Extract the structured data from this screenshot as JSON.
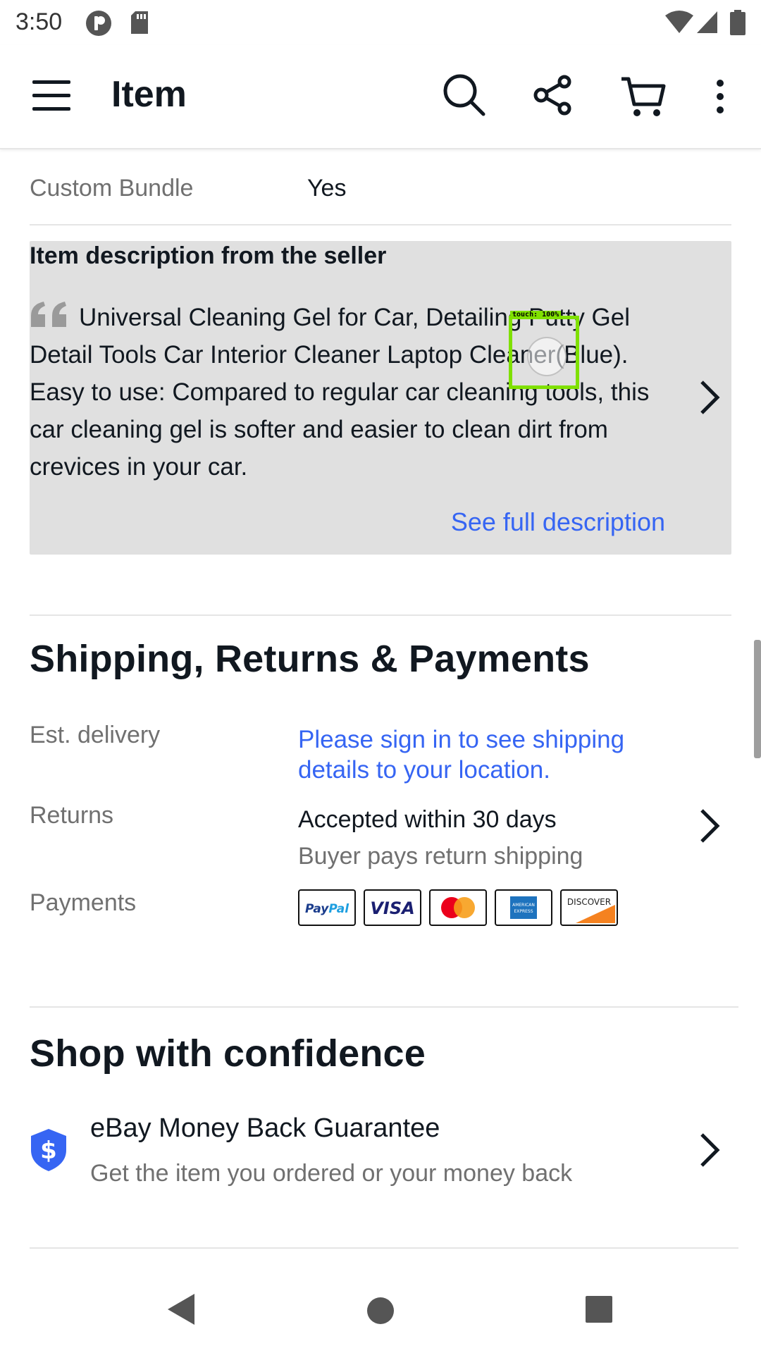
{
  "status_bar": {
    "time": "3:50"
  },
  "app_bar": {
    "title": "Item"
  },
  "specifics": {
    "label": "Custom Bundle",
    "value": "Yes"
  },
  "description": {
    "heading": "Item description from the seller",
    "text": "Universal Cleaning Gel for Car, Detailing Putty Gel Detail Tools Car Interior Cleaner Laptop Cleaner(Blue). Easy to use: Compared to regular car cleaning tools, this car cleaning gel is softer and easier to clean dirt from crevices in your car.",
    "see_full": "See full description"
  },
  "touch_overlay": {
    "label": "touch: 100%"
  },
  "shipping": {
    "heading": "Shipping, Returns & Payments",
    "delivery_label": "Est. delivery",
    "delivery_value": "Please sign in to see shipping details to your location.",
    "returns_label": "Returns",
    "returns_value": "Accepted within 30 days",
    "returns_sub": "Buyer pays return shipping",
    "payments_label": "Payments",
    "payment_methods": [
      "PayPal",
      "VISA",
      "Mastercard",
      "AMERICAN EXPRESS",
      "DISCOVER"
    ]
  },
  "confidence": {
    "heading": "Shop with confidence",
    "guarantee_title": "eBay Money Back Guarantee",
    "guarantee_sub": "Get the item you ordered or your money back"
  },
  "colors": {
    "link_blue": "#3665f3",
    "shield_blue": "#3665f3",
    "card_gray": "#e0e0e0"
  }
}
